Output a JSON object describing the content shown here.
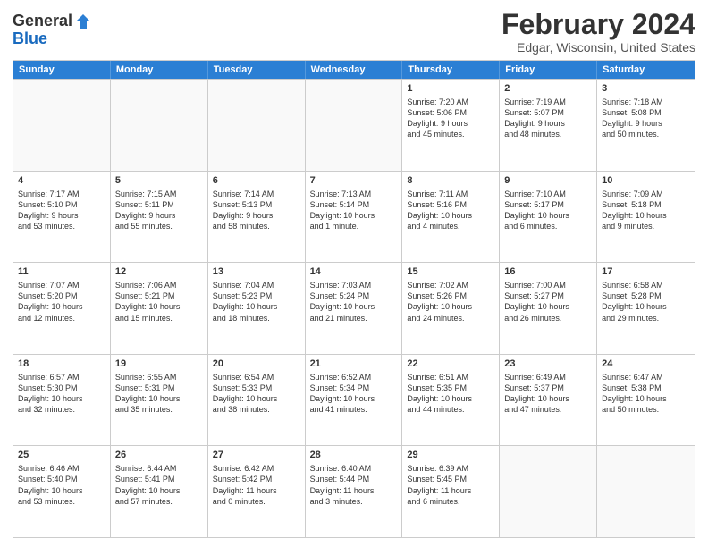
{
  "header": {
    "logo_general": "General",
    "logo_blue": "Blue",
    "month_title": "February 2024",
    "location": "Edgar, Wisconsin, United States"
  },
  "days_of_week": [
    "Sunday",
    "Monday",
    "Tuesday",
    "Wednesday",
    "Thursday",
    "Friday",
    "Saturday"
  ],
  "weeks": [
    [
      {
        "day": "",
        "info": ""
      },
      {
        "day": "",
        "info": ""
      },
      {
        "day": "",
        "info": ""
      },
      {
        "day": "",
        "info": ""
      },
      {
        "day": "1",
        "info": "Sunrise: 7:20 AM\nSunset: 5:06 PM\nDaylight: 9 hours\nand 45 minutes."
      },
      {
        "day": "2",
        "info": "Sunrise: 7:19 AM\nSunset: 5:07 PM\nDaylight: 9 hours\nand 48 minutes."
      },
      {
        "day": "3",
        "info": "Sunrise: 7:18 AM\nSunset: 5:08 PM\nDaylight: 9 hours\nand 50 minutes."
      }
    ],
    [
      {
        "day": "4",
        "info": "Sunrise: 7:17 AM\nSunset: 5:10 PM\nDaylight: 9 hours\nand 53 minutes."
      },
      {
        "day": "5",
        "info": "Sunrise: 7:15 AM\nSunset: 5:11 PM\nDaylight: 9 hours\nand 55 minutes."
      },
      {
        "day": "6",
        "info": "Sunrise: 7:14 AM\nSunset: 5:13 PM\nDaylight: 9 hours\nand 58 minutes."
      },
      {
        "day": "7",
        "info": "Sunrise: 7:13 AM\nSunset: 5:14 PM\nDaylight: 10 hours\nand 1 minute."
      },
      {
        "day": "8",
        "info": "Sunrise: 7:11 AM\nSunset: 5:16 PM\nDaylight: 10 hours\nand 4 minutes."
      },
      {
        "day": "9",
        "info": "Sunrise: 7:10 AM\nSunset: 5:17 PM\nDaylight: 10 hours\nand 6 minutes."
      },
      {
        "day": "10",
        "info": "Sunrise: 7:09 AM\nSunset: 5:18 PM\nDaylight: 10 hours\nand 9 minutes."
      }
    ],
    [
      {
        "day": "11",
        "info": "Sunrise: 7:07 AM\nSunset: 5:20 PM\nDaylight: 10 hours\nand 12 minutes."
      },
      {
        "day": "12",
        "info": "Sunrise: 7:06 AM\nSunset: 5:21 PM\nDaylight: 10 hours\nand 15 minutes."
      },
      {
        "day": "13",
        "info": "Sunrise: 7:04 AM\nSunset: 5:23 PM\nDaylight: 10 hours\nand 18 minutes."
      },
      {
        "day": "14",
        "info": "Sunrise: 7:03 AM\nSunset: 5:24 PM\nDaylight: 10 hours\nand 21 minutes."
      },
      {
        "day": "15",
        "info": "Sunrise: 7:02 AM\nSunset: 5:26 PM\nDaylight: 10 hours\nand 24 minutes."
      },
      {
        "day": "16",
        "info": "Sunrise: 7:00 AM\nSunset: 5:27 PM\nDaylight: 10 hours\nand 26 minutes."
      },
      {
        "day": "17",
        "info": "Sunrise: 6:58 AM\nSunset: 5:28 PM\nDaylight: 10 hours\nand 29 minutes."
      }
    ],
    [
      {
        "day": "18",
        "info": "Sunrise: 6:57 AM\nSunset: 5:30 PM\nDaylight: 10 hours\nand 32 minutes."
      },
      {
        "day": "19",
        "info": "Sunrise: 6:55 AM\nSunset: 5:31 PM\nDaylight: 10 hours\nand 35 minutes."
      },
      {
        "day": "20",
        "info": "Sunrise: 6:54 AM\nSunset: 5:33 PM\nDaylight: 10 hours\nand 38 minutes."
      },
      {
        "day": "21",
        "info": "Sunrise: 6:52 AM\nSunset: 5:34 PM\nDaylight: 10 hours\nand 41 minutes."
      },
      {
        "day": "22",
        "info": "Sunrise: 6:51 AM\nSunset: 5:35 PM\nDaylight: 10 hours\nand 44 minutes."
      },
      {
        "day": "23",
        "info": "Sunrise: 6:49 AM\nSunset: 5:37 PM\nDaylight: 10 hours\nand 47 minutes."
      },
      {
        "day": "24",
        "info": "Sunrise: 6:47 AM\nSunset: 5:38 PM\nDaylight: 10 hours\nand 50 minutes."
      }
    ],
    [
      {
        "day": "25",
        "info": "Sunrise: 6:46 AM\nSunset: 5:40 PM\nDaylight: 10 hours\nand 53 minutes."
      },
      {
        "day": "26",
        "info": "Sunrise: 6:44 AM\nSunset: 5:41 PM\nDaylight: 10 hours\nand 57 minutes."
      },
      {
        "day": "27",
        "info": "Sunrise: 6:42 AM\nSunset: 5:42 PM\nDaylight: 11 hours\nand 0 minutes."
      },
      {
        "day": "28",
        "info": "Sunrise: 6:40 AM\nSunset: 5:44 PM\nDaylight: 11 hours\nand 3 minutes."
      },
      {
        "day": "29",
        "info": "Sunrise: 6:39 AM\nSunset: 5:45 PM\nDaylight: 11 hours\nand 6 minutes."
      },
      {
        "day": "",
        "info": ""
      },
      {
        "day": "",
        "info": ""
      }
    ]
  ]
}
